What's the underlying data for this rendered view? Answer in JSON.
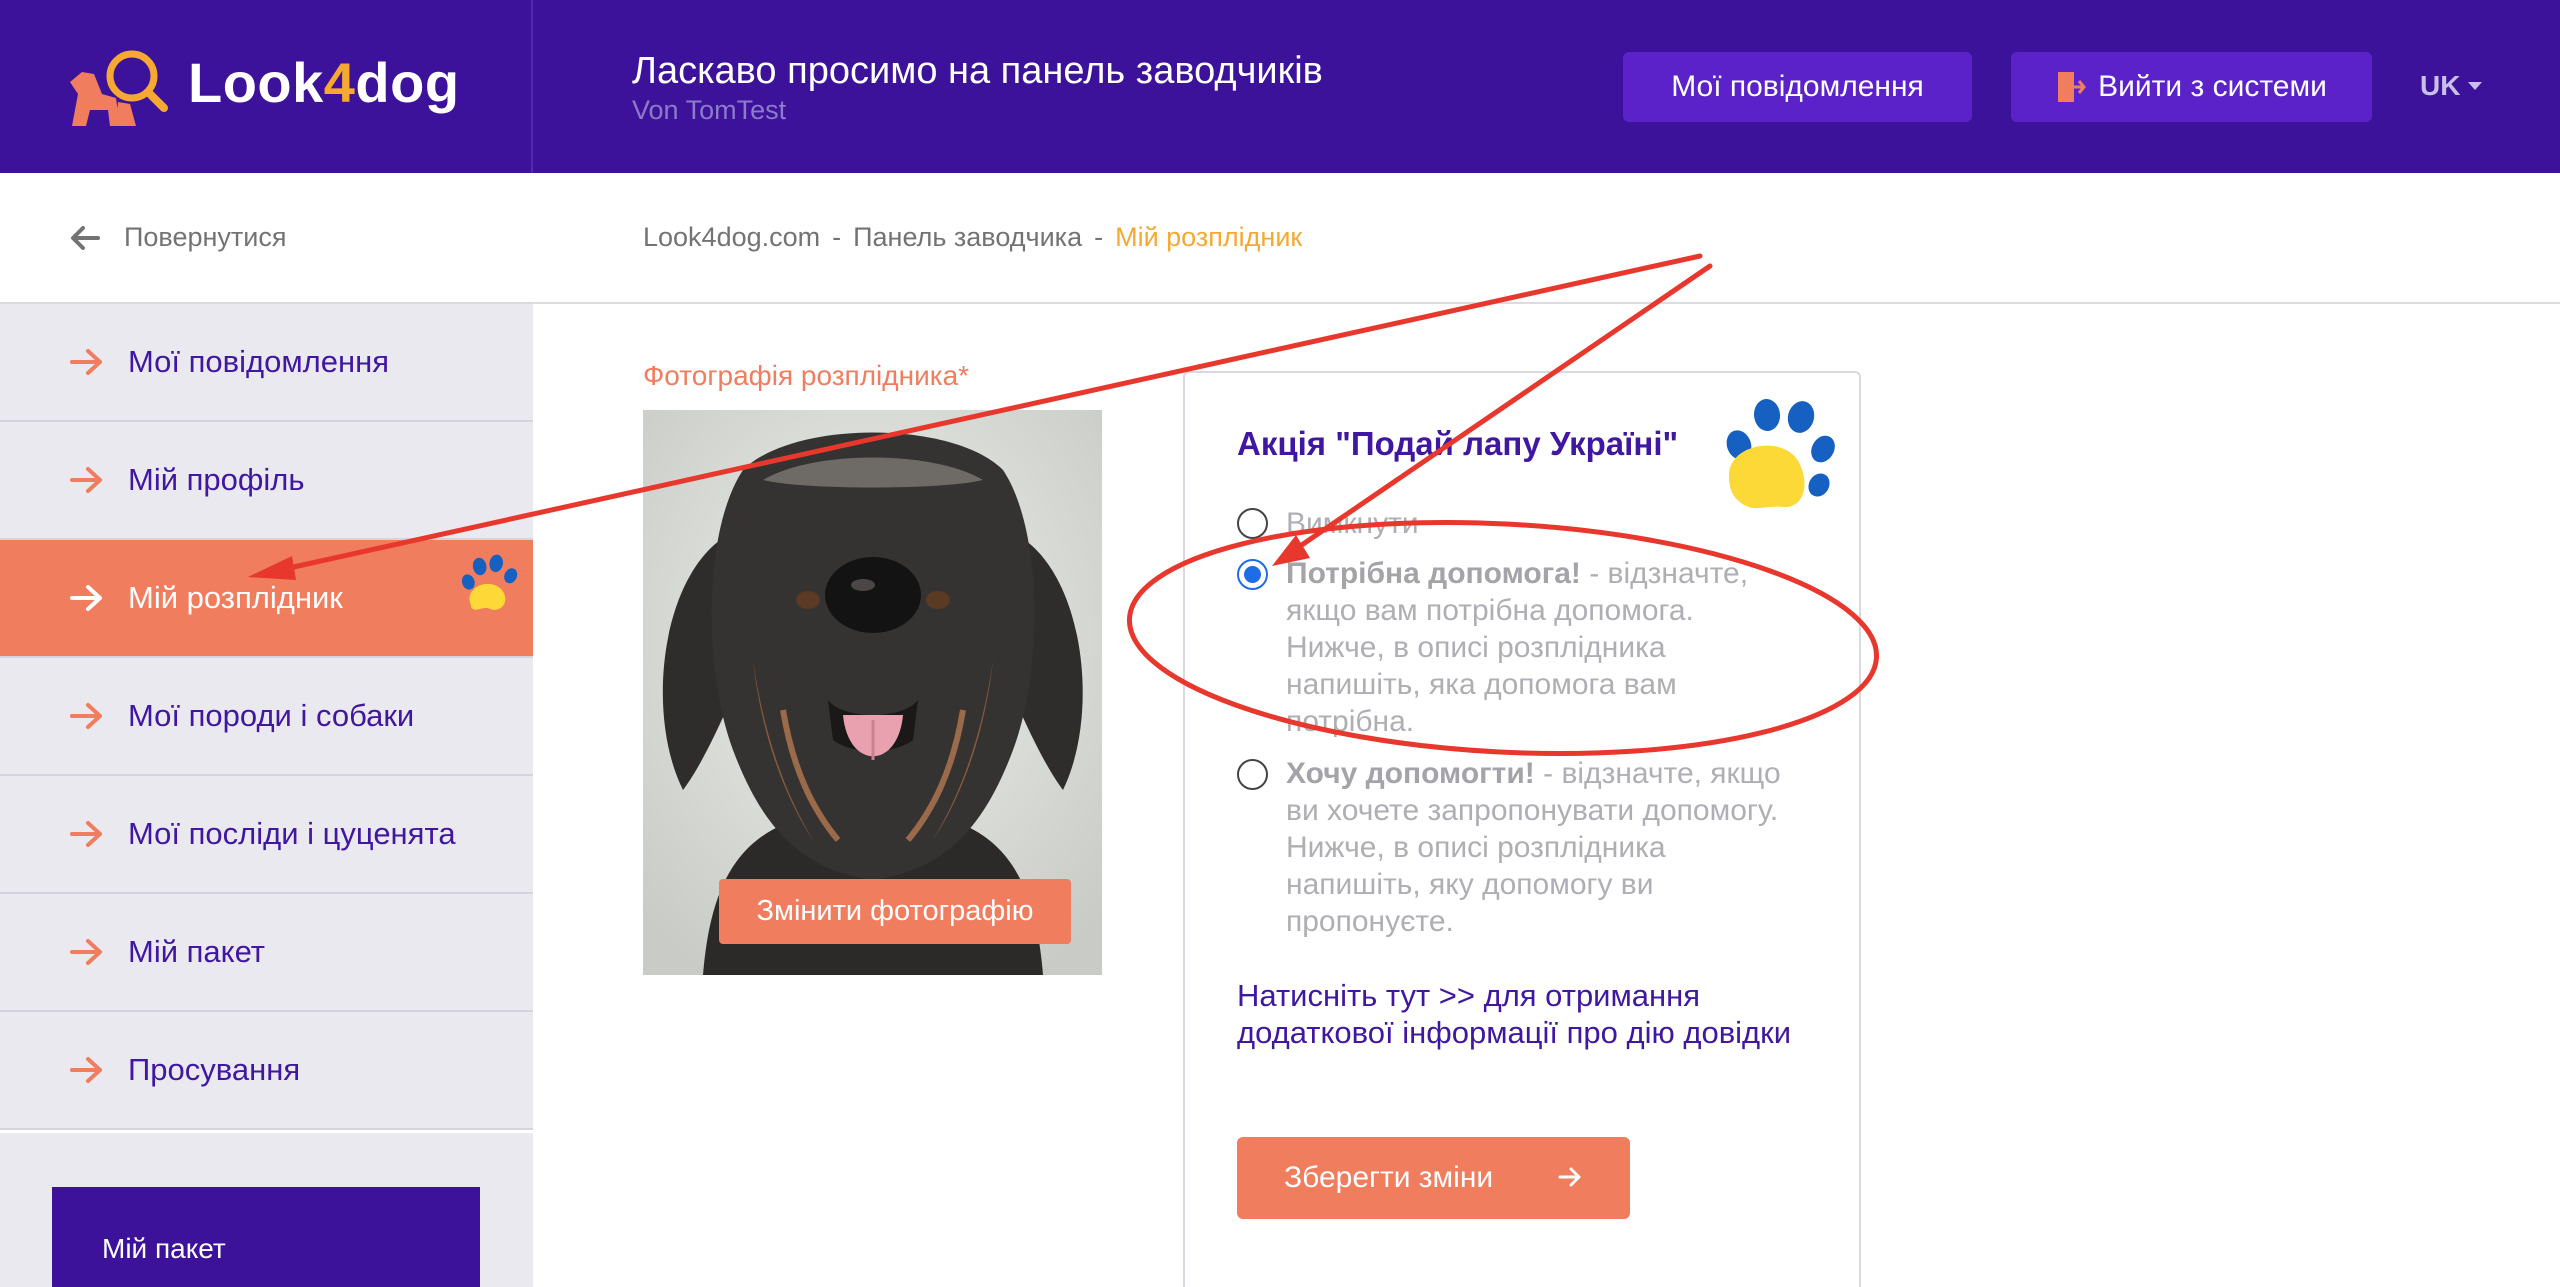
{
  "header": {
    "logo_prefix": "Look",
    "logo_digit": "4",
    "logo_suffix": "dog",
    "welcome_title": "Ласкаво просимо на панель заводчиків",
    "welcome_subtitle": "Von TomTest",
    "messages_button": "Мої повідомлення",
    "logout_button": "Вийти з системи",
    "language": "UK"
  },
  "sidebar": {
    "back_label": "Повернутися",
    "items": [
      {
        "label": "Мої повідомлення"
      },
      {
        "label": "Мій профіль"
      },
      {
        "label": "Мій розплідник",
        "active": true
      },
      {
        "label": "Мої породи і собаки"
      },
      {
        "label": "Мої посліди і цуценята"
      },
      {
        "label": "Мій пакет"
      },
      {
        "label": "Просування"
      }
    ],
    "package_card_title": "Мій пакет"
  },
  "breadcrumb": {
    "items": [
      "Look4dog.com",
      "Панель заводчика",
      "Мій розплідник"
    ],
    "separator": "-"
  },
  "photo": {
    "label": "Фотографія розплідника*",
    "change_button": "Змінити фотографію"
  },
  "campaign": {
    "title": "Акція \"Подай лапу Україні\"",
    "options": [
      {
        "title": "",
        "text": "Вимкнути",
        "checked": false
      },
      {
        "title": "Потрібна допомога!",
        "text": " - відзначте, якщо вам потрібна допомога. Нижче, в описі розплідника напишіть, яка допомога вам потрібна.",
        "checked": true
      },
      {
        "title": "Хочу допомогти!",
        "text": " - відзначте, якщо ви хочете запропонувати допомогу. Нижче, в описі розплідника напишіть, яку допомогу ви пропонуєте.",
        "checked": false
      }
    ],
    "info_link": "Натисніть тут >> для отримання додаткової інформації про дію довідки",
    "save_button": "Зберегти зміни"
  },
  "colors": {
    "header_bg": "#3d129a",
    "accent_orange": "#f07d5e",
    "accent_yellow": "#f5a832",
    "header_button": "#5b22c9",
    "annotation_red": "#e8372c",
    "paw_blue": "#1560c0",
    "paw_yellow": "#fcd937"
  }
}
